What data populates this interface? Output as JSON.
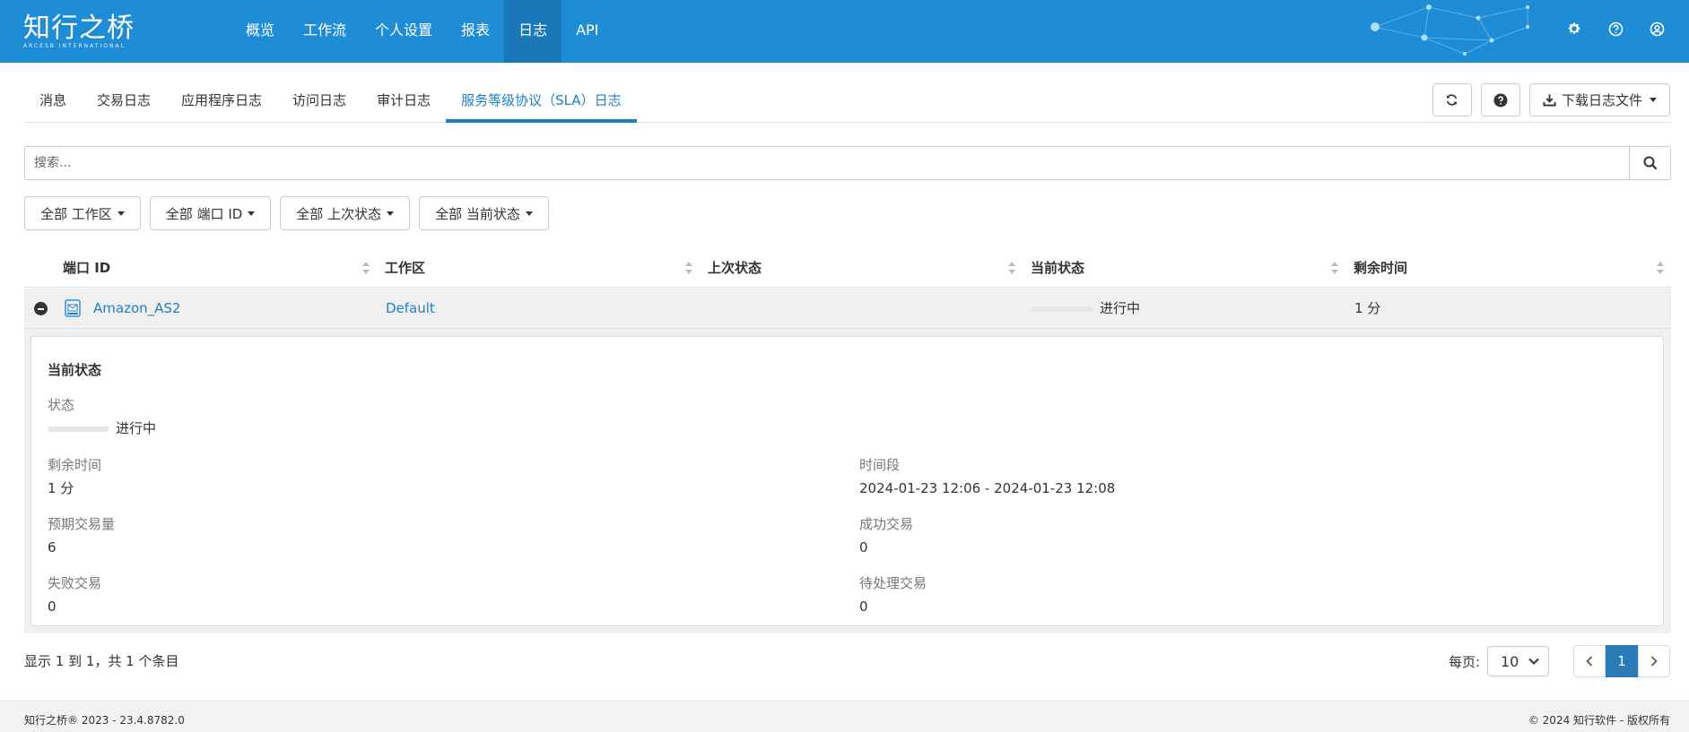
{
  "brand": {
    "name": "知行之桥",
    "sub": "ARCESB INTERNATIONAL"
  },
  "nav": [
    {
      "label": "概览",
      "active": false
    },
    {
      "label": "工作流",
      "active": false
    },
    {
      "label": "个人设置",
      "active": false
    },
    {
      "label": "报表",
      "active": false
    },
    {
      "label": "日志",
      "active": true
    },
    {
      "label": "API",
      "active": false
    }
  ],
  "header_icons": [
    "gear-icon",
    "help-circle-icon",
    "user-circle-icon"
  ],
  "tabs": [
    {
      "label": "消息",
      "active": false
    },
    {
      "label": "交易日志",
      "active": false
    },
    {
      "label": "应用程序日志",
      "active": false
    },
    {
      "label": "访问日志",
      "active": false
    },
    {
      "label": "审计日志",
      "active": false
    },
    {
      "label": "服务等级协议（SLA）日志",
      "active": true
    }
  ],
  "tools": {
    "download_label": "下载日志文件"
  },
  "search": {
    "placeholder": "搜索..."
  },
  "filters": [
    "全部 工作区",
    "全部 端口 ID",
    "全部 上次状态",
    "全部 当前状态"
  ],
  "table": {
    "columns": [
      "端口 ID",
      "工作区",
      "上次状态",
      "当前状态",
      "剩余时间"
    ],
    "rows": [
      {
        "port_id": "Amazon_AS2",
        "workspace": "Default",
        "last_status": "",
        "current_status": "进行中",
        "remaining": "1 分"
      }
    ]
  },
  "detail": {
    "heading": "当前状态",
    "status_label": "状态",
    "status_value": "进行中",
    "remaining_label": "剩余时间",
    "remaining_value": "1 分",
    "period_label": "时间段",
    "period_value": "2024-01-23 12:06 - 2024-01-23 12:08",
    "expected_label": "预期交易量",
    "expected_value": "6",
    "success_label": "成功交易",
    "success_value": "0",
    "failed_label": "失败交易",
    "failed_value": "0",
    "pending_label": "待处理交易",
    "pending_value": "0"
  },
  "pagination": {
    "summary": "显示 1 到 1，共 1 个条目",
    "per_page_label": "每页:",
    "per_page_value": "10",
    "current_page": "1"
  },
  "footer": {
    "left": "知行之桥® 2023 - 23.4.8782.0",
    "right": "© 2024 知行软件 - 版权所有"
  },
  "colors": {
    "header": "#1f8dd6",
    "nav_active": "#1a78b8",
    "accent": "#1f7fc6"
  }
}
